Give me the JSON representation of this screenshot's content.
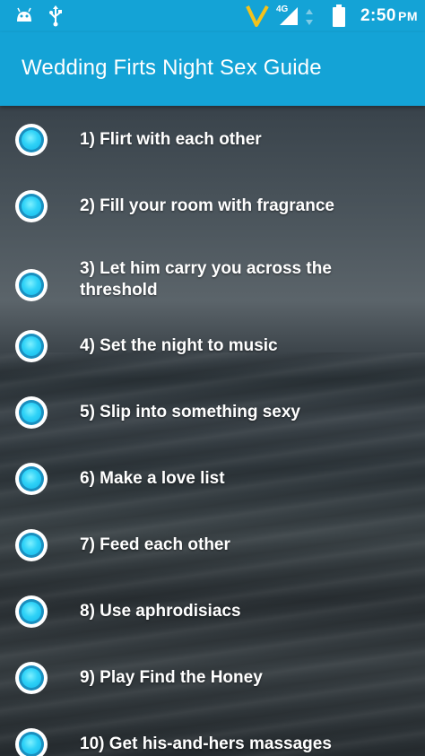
{
  "status_bar": {
    "network": "4G",
    "time": "2:50",
    "ampm": "PM",
    "icons": [
      "android-icon",
      "usb-icon",
      "v-carrier-icon",
      "signal-icon",
      "data-arrows-icon",
      "battery-icon"
    ]
  },
  "app_bar": {
    "title": "Wedding Firts Night Sex Guide"
  },
  "colors": {
    "accent": "#14a3d6",
    "bullet": "#2fd2f7",
    "text": "#ffffff"
  },
  "items": [
    {
      "label": "1) Flirt with each other"
    },
    {
      "label": "2) Fill your room with fragrance"
    },
    {
      "label": "3) Let him carry you across the threshold"
    },
    {
      "label": "4) Set the night to music"
    },
    {
      "label": "5) Slip into something sexy"
    },
    {
      "label": "6) Make a love list"
    },
    {
      "label": "7) Feed each other"
    },
    {
      "label": "8) Use aphrodisiacs"
    },
    {
      "label": "9) Play Find the Honey"
    },
    {
      "label": "10) Get his-and-hers massages"
    }
  ]
}
